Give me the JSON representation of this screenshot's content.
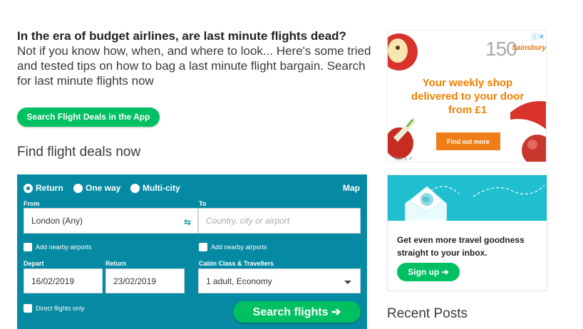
{
  "intro": {
    "lead": "In the era of budget airlines, are last minute flights dead?",
    "body": "Not if you know how, when, and where to look... Here's some tried and tested tips on how to bag a last minute flight bargain. Search for last minute flights now"
  },
  "app_button": "Search Flight Deals in the App",
  "find_heading": "Find flight deals now",
  "search": {
    "trip_types": [
      "Return",
      "One way",
      "Multi-city"
    ],
    "selected_trip": "Return",
    "map_link": "Map",
    "from_label": "From",
    "from_value": "London (Any)",
    "to_label": "To",
    "to_placeholder": "Country, city or airport",
    "add_nearby_from": "Add nearby airports",
    "add_nearby_to": "Add nearby airports",
    "depart_label": "Depart",
    "depart_value": "16/02/2019",
    "return_label": "Return",
    "return_value": "23/02/2019",
    "cabin_label": "Cabin Class & Travellers",
    "cabin_value": "1 adult, Economy",
    "direct_only": "Direct flights only",
    "search_button": "Search flights ➔"
  },
  "ad": {
    "number": "150",
    "brand": "Sainsburys",
    "headline": "Your weekly shop delivered to your door from £1",
    "cta": "Find out more",
    "terms": "T&C's ↗",
    "close": "ⓘ✕"
  },
  "newsletter": {
    "text": "Get even more travel goodness straight to your inbox.",
    "button": "Sign up ➔"
  },
  "recent_posts": "Recent Posts",
  "colors": {
    "panel": "#068aa4",
    "green": "#00c061",
    "ad_orange": "#f07f00",
    "newsletter_teal": "#1fbfcf"
  }
}
